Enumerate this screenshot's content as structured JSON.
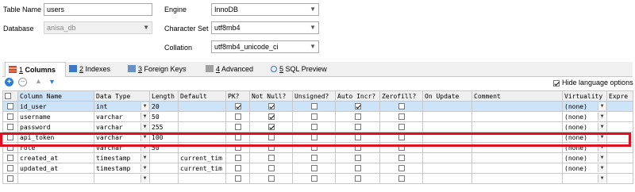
{
  "form": {
    "table_name_label": "Table Name",
    "table_name_value": "users",
    "database_label": "Database",
    "database_value": "anisa_db",
    "engine_label": "Engine",
    "engine_value": "InnoDB",
    "charset_label": "Character Set",
    "charset_value": "utf8mb4",
    "collation_label": "Collation",
    "collation_value": "utf8mb4_unicode_ci"
  },
  "tabs": [
    {
      "number": "1",
      "label": "Columns"
    },
    {
      "number": "2",
      "label": "Indexes"
    },
    {
      "number": "3",
      "label": "Foreign Keys"
    },
    {
      "number": "4",
      "label": "Advanced"
    },
    {
      "number": "5",
      "label": "SQL Preview"
    }
  ],
  "toolbar": {
    "hide_language_options": "Hide language options"
  },
  "grid": {
    "headers": [
      "Column Name",
      "Data Type",
      "Length",
      "Default",
      "PK?",
      "Not Null?",
      "Unsigned?",
      "Auto Incr?",
      "Zerofill?",
      "On Update",
      "Comment",
      "Virtuality",
      "Expre"
    ],
    "rows": [
      {
        "name": "id_user",
        "type": "int",
        "length": "20",
        "default": "",
        "pk": true,
        "notnull": true,
        "unsigned": false,
        "autoincr": true,
        "zerofill": false,
        "virtuality": "(none)"
      },
      {
        "name": "username",
        "type": "varchar",
        "length": "50",
        "default": "",
        "pk": false,
        "notnull": true,
        "unsigned": false,
        "autoincr": false,
        "zerofill": false,
        "virtuality": "(none)"
      },
      {
        "name": "password",
        "type": "varchar",
        "length": "255",
        "default": "",
        "pk": false,
        "notnull": true,
        "unsigned": false,
        "autoincr": false,
        "zerofill": false,
        "virtuality": "(none)"
      },
      {
        "name": "api_token",
        "type": "varchar",
        "length": "100",
        "default": "",
        "pk": false,
        "notnull": false,
        "unsigned": false,
        "autoincr": false,
        "zerofill": false,
        "virtuality": "(none)"
      },
      {
        "name": "role",
        "type": "varchar",
        "length": "50",
        "default": "",
        "pk": false,
        "notnull": false,
        "unsigned": false,
        "autoincr": false,
        "zerofill": false,
        "virtuality": "(none)"
      },
      {
        "name": "created_at",
        "type": "timestamp",
        "length": "",
        "default": "current_tim",
        "pk": false,
        "notnull": false,
        "unsigned": false,
        "autoincr": false,
        "zerofill": false,
        "virtuality": "(none)"
      },
      {
        "name": "updated_at",
        "type": "timestamp",
        "length": "",
        "default": "current_tim",
        "pk": false,
        "notnull": false,
        "unsigned": false,
        "autoincr": false,
        "zerofill": false,
        "virtuality": "(none)"
      },
      {
        "name": "",
        "type": "",
        "length": "",
        "default": "",
        "pk": false,
        "notnull": false,
        "unsigned": false,
        "autoincr": false,
        "zerofill": false,
        "virtuality": ""
      }
    ]
  },
  "colors": {
    "highlight": "#e01020",
    "selected_row": "#cde3f7"
  }
}
